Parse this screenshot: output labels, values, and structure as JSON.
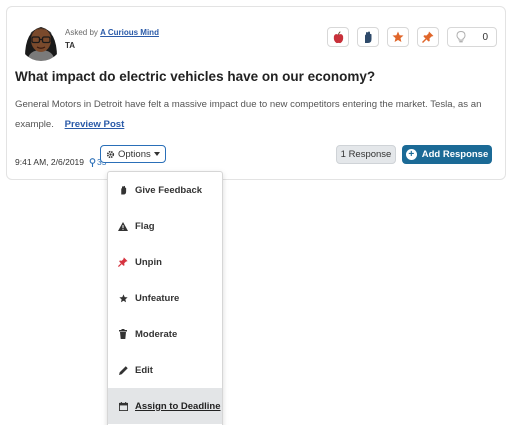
{
  "post": {
    "asked_prefix": "Asked by",
    "author": "A Curious Mind",
    "role": "TA",
    "like_count": "0",
    "title": "What impact do electric vehicles have on our economy?",
    "body": "General Motors in Detroit have felt a massive impact due to new competitors entering the market. Tesla, as an example.",
    "preview_label": "Preview Post",
    "timestamp": "9:41 AM, 2/6/2019",
    "views": "35",
    "options_label": "Options",
    "response_count_label": "1 Response",
    "add_response_label": "Add Response"
  },
  "icons": {
    "toolbar": [
      "apple-icon",
      "hand-icon",
      "star-icon",
      "pin-icon",
      "lightbulb-icon"
    ],
    "menu": [
      "hand-icon",
      "warning-icon",
      "pin-icon",
      "star-icon",
      "trash-icon",
      "pencil-icon",
      "calendar-icon"
    ]
  },
  "menu": {
    "items": [
      {
        "label": "Give Feedback"
      },
      {
        "label": "Flag"
      },
      {
        "label": "Unpin"
      },
      {
        "label": "Unfeature"
      },
      {
        "label": "Moderate"
      },
      {
        "label": "Edit"
      },
      {
        "label": "Assign to Deadline",
        "active": true
      }
    ]
  },
  "colors": {
    "accent": "#1b6a96",
    "link": "#2a5aa8",
    "apple": "#c8303a",
    "star": "#e0662a",
    "pin": "#e0662a"
  }
}
